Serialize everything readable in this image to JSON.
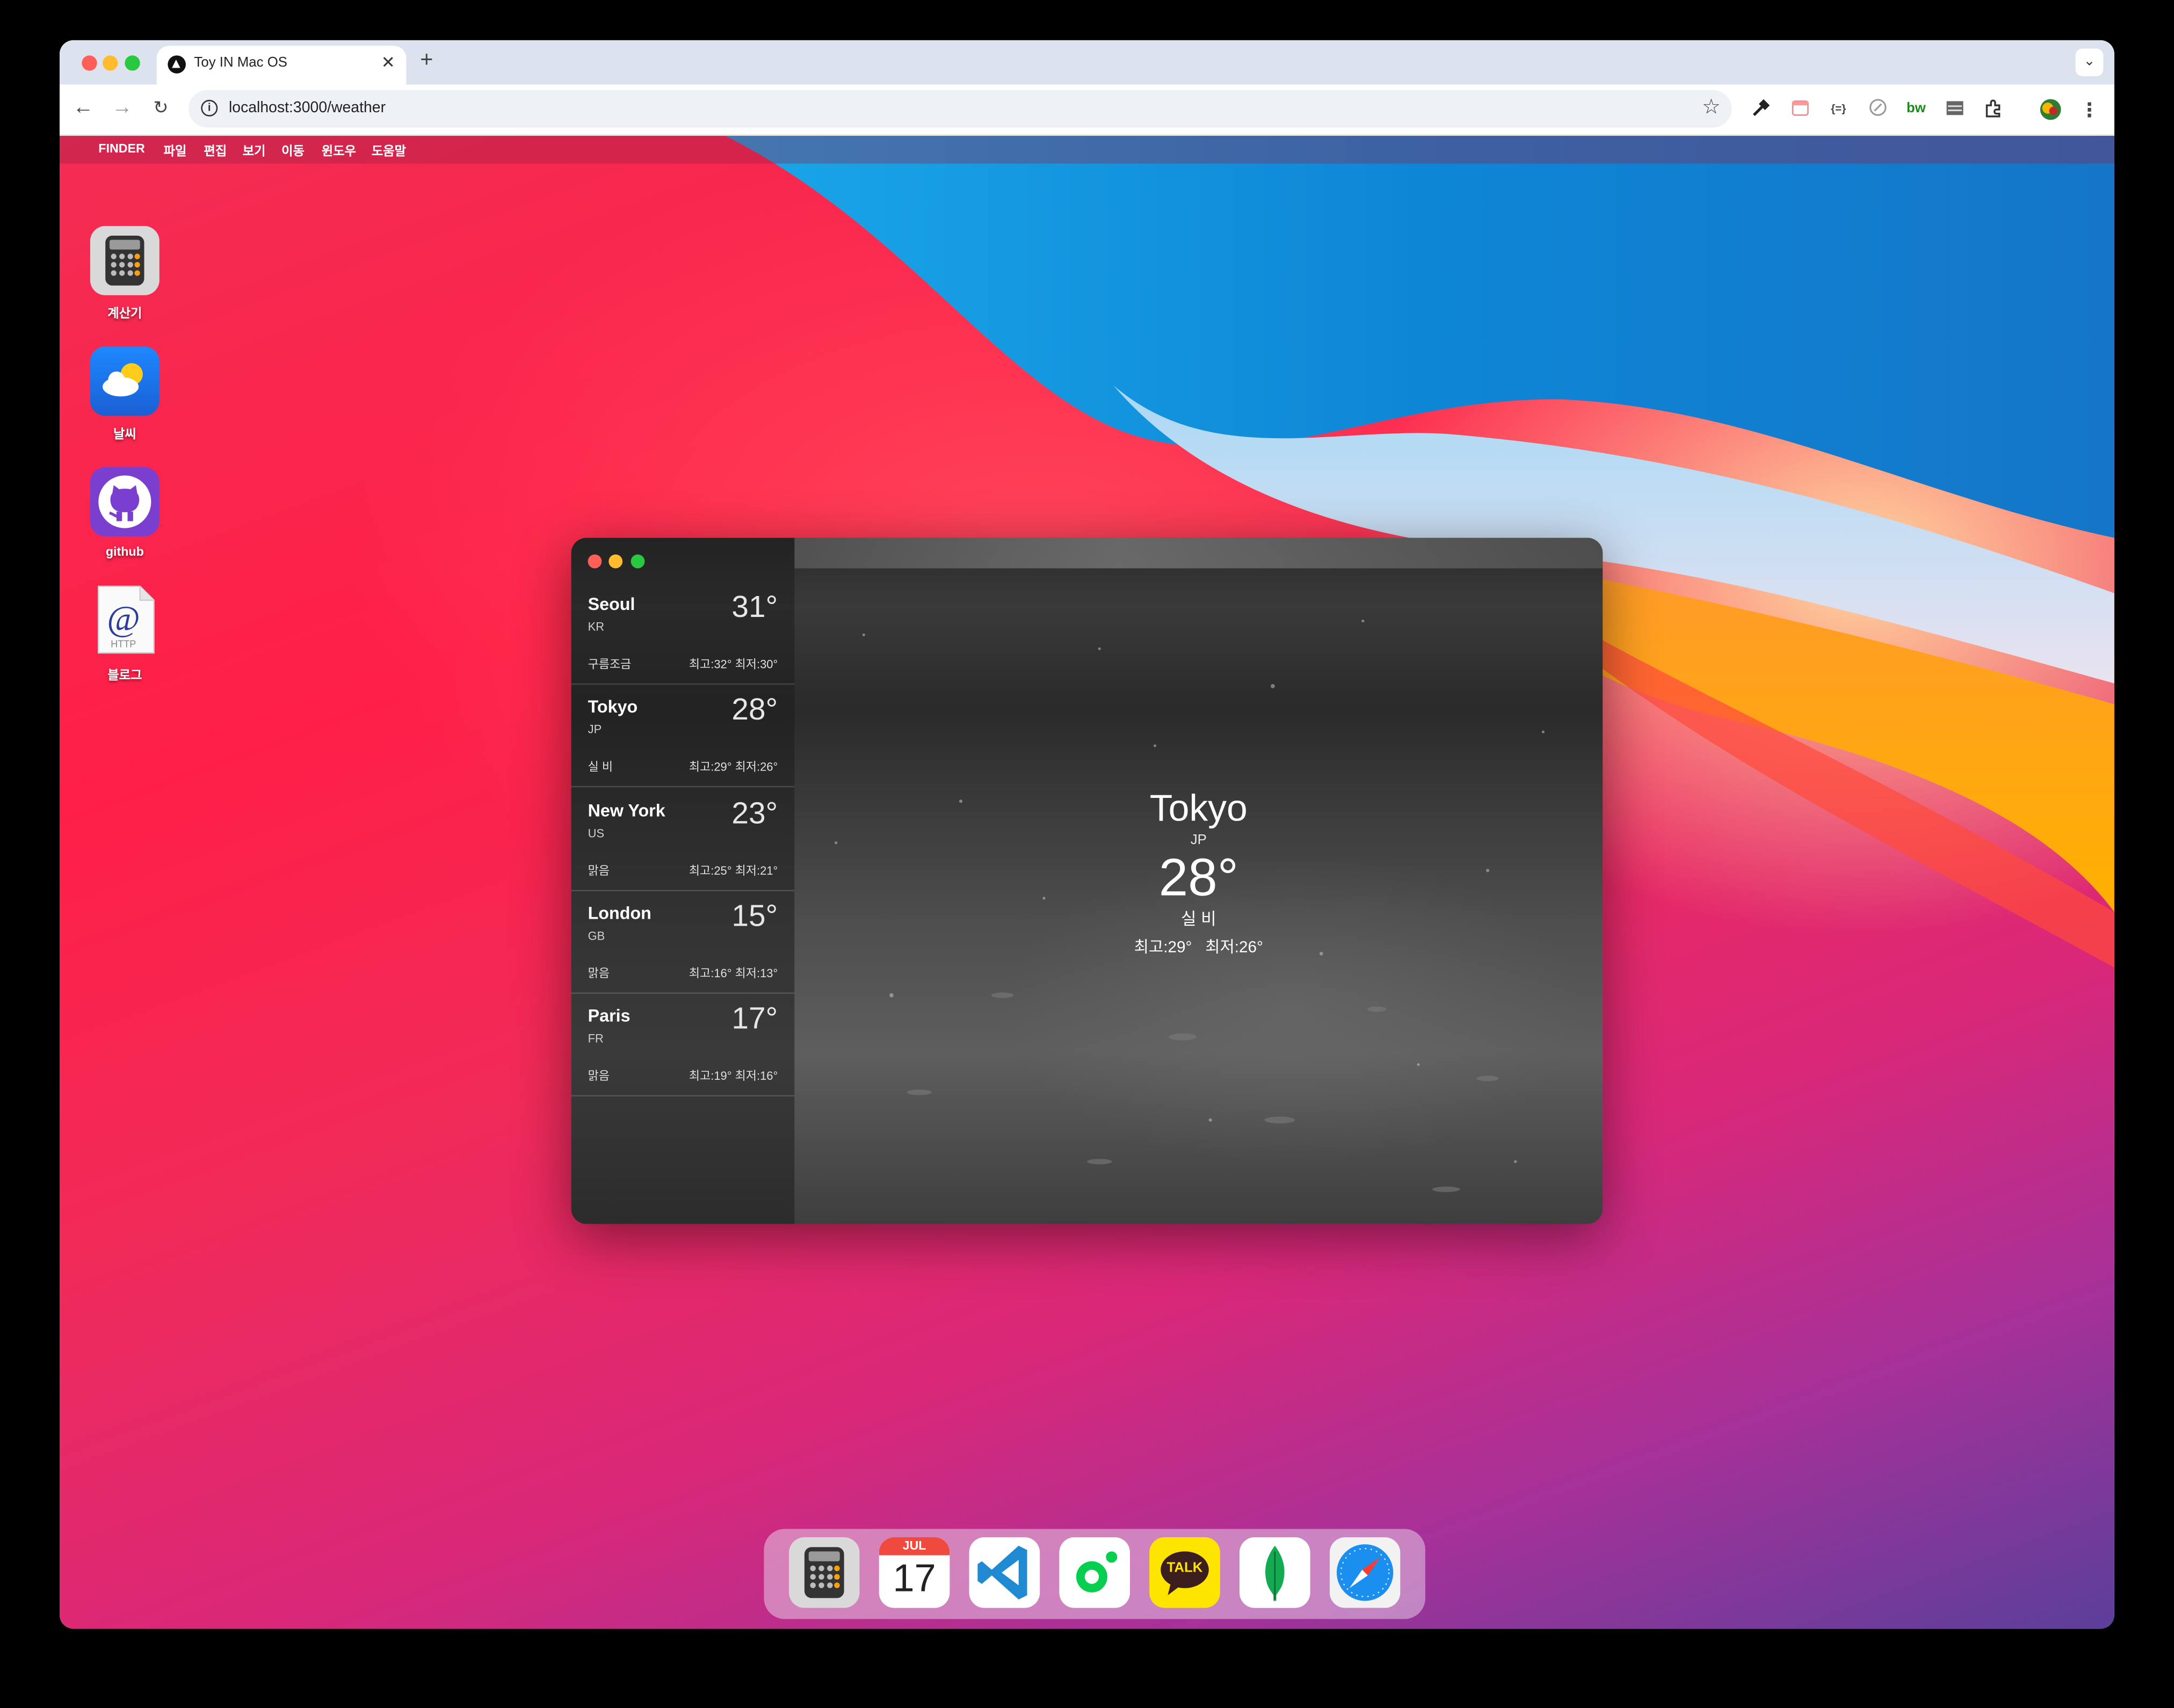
{
  "browser": {
    "tab_title": "Toy IN Mac OS",
    "url": "localhost:3000/weather"
  },
  "menubar": {
    "items": [
      "FINDER",
      "파일",
      "편집",
      "보기",
      "이동",
      "윈도우",
      "도움말"
    ]
  },
  "desktop_icons": [
    {
      "label": "계산기",
      "icon": "calculator-icon"
    },
    {
      "label": "날씨",
      "icon": "weather-icon"
    },
    {
      "label": "github",
      "icon": "github-icon"
    },
    {
      "label": "블로그",
      "icon": "http-icon"
    }
  ],
  "weather": {
    "cities": [
      {
        "name": "Seoul",
        "country": "KR",
        "temp": "31°",
        "desc": "구름조금",
        "hilo": "최고:32° 최저:30°"
      },
      {
        "name": "Tokyo",
        "country": "JP",
        "temp": "28°",
        "desc": "실 비",
        "hilo": "최고:29° 최저:26°"
      },
      {
        "name": "New York",
        "country": "US",
        "temp": "23°",
        "desc": "맑음",
        "hilo": "최고:25° 최저:21°"
      },
      {
        "name": "London",
        "country": "GB",
        "temp": "15°",
        "desc": "맑음",
        "hilo": "최고:16° 최저:13°"
      },
      {
        "name": "Paris",
        "country": "FR",
        "temp": "17°",
        "desc": "맑음",
        "hilo": "최고:19° 최저:16°"
      }
    ],
    "selected": {
      "name": "Tokyo",
      "country": "JP",
      "temp": "28°",
      "desc": "실 비",
      "hilo": "최고:29°   최저:26°"
    }
  },
  "dock": {
    "calendar_month": "JUL",
    "calendar_day": "17",
    "kakao_label": "TALK",
    "apps": [
      "calculator-icon",
      "calendar-icon",
      "vscode-icon",
      "naver-band-icon",
      "kakaotalk-icon",
      "mongodb-icon",
      "safari-icon"
    ]
  }
}
